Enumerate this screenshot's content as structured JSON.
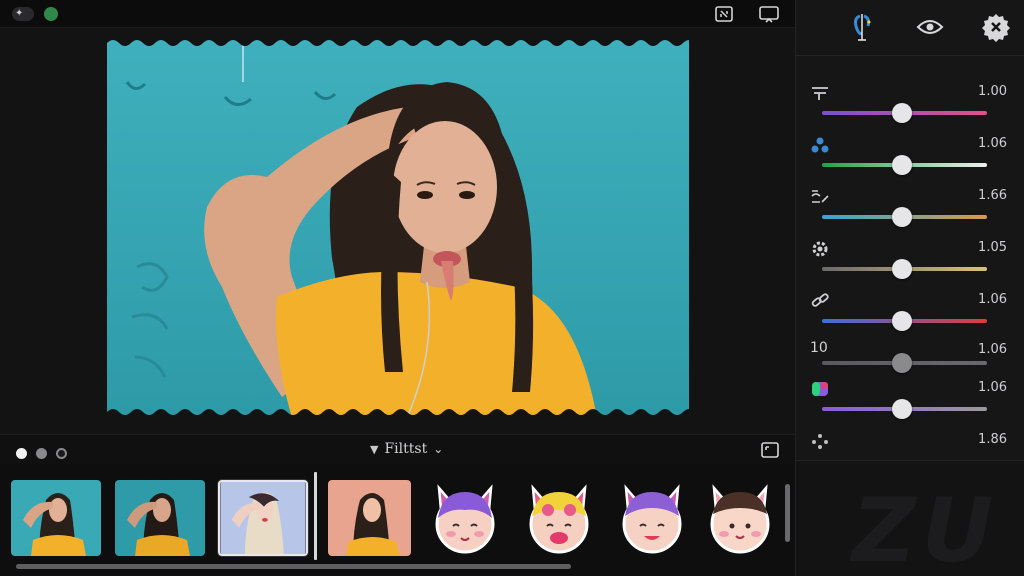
{
  "topbar": {
    "toggle_icon": "flash-icon",
    "status_color": "#2f8a4a",
    "crop_icon": "crop-icon",
    "cast_icon": "cast-icon"
  },
  "canvas": {
    "photo_description_colors": {
      "background": "#39a9b6",
      "shirt": "#f3b12b",
      "hair": "#2b1f1a"
    }
  },
  "filterbar": {
    "dots": [
      "#f2f2f2",
      "#8a8a8c",
      "#3a3a3c"
    ],
    "dropdown_label": "Filttst",
    "expand_icon": "fullscreen-icon"
  },
  "strip": {
    "thumbnails": [
      {
        "kind": "photo",
        "tint": "#39a9b6",
        "selected": false
      },
      {
        "kind": "photo",
        "tint": "#2f9aa8",
        "selected": false
      },
      {
        "kind": "photo",
        "tint": "#b7c6e8",
        "selected": true
      },
      {
        "kind": "photo",
        "tint": "#e8a48f",
        "selected": false
      }
    ],
    "stickers": [
      {
        "name": "cat-face-sticker-purple",
        "hair": "#8a5bd6",
        "ears": "#d65ba8"
      },
      {
        "name": "cat-face-sticker-yellow",
        "hair": "#f2d23a",
        "ears": "#e85a8a"
      },
      {
        "name": "cat-face-sticker-violet",
        "hair": "#8c5fd4",
        "ears": "#c95cb0"
      },
      {
        "name": "cat-face-sticker-brown",
        "hair": "#4a3026",
        "ears": "#f0a7b5"
      }
    ]
  },
  "panel": {
    "header_icons": [
      "magic-wand-icon",
      "eye-icon",
      "settings-gear-icon"
    ],
    "adjustments": [
      {
        "icon": "lines-icon",
        "value": "1.00",
        "level": 0.49,
        "track_from": "#7a4fd6",
        "track_to": "#e2508a"
      },
      {
        "icon": "people-icon",
        "value": "1.06",
        "level": 0.49,
        "track_from": "#1fa24a",
        "track_to": "#f0f0f0"
      },
      {
        "icon": "tone-curve-icon",
        "value": "1.66",
        "level": 0.49,
        "track_from": "#35a6d2",
        "track_to": "#d99a4a"
      },
      {
        "icon": "gear-icon",
        "value": "1.05",
        "level": 0.49,
        "track_from": "#6a6a6c",
        "track_to": "#d8c27a"
      },
      {
        "icon": "link-icon",
        "value": "1.06",
        "level": 0.49,
        "track_from": "#3a6ee0",
        "track_to": "#e03a3a"
      },
      {
        "icon": "text-10",
        "label": "10",
        "value": "1.06",
        "level": 0.49,
        "track_from": "#5a5a5c",
        "track_to": "#6a6a6c"
      },
      {
        "icon": "color-palette-icon",
        "value": "1.06",
        "level": 0.49,
        "track_from": "#8a5ae0",
        "track_to": "#9a9a9c"
      },
      {
        "icon": "sparkle-move-icon",
        "value": "1.86",
        "level": null
      }
    ],
    "watermark": "ZU"
  }
}
